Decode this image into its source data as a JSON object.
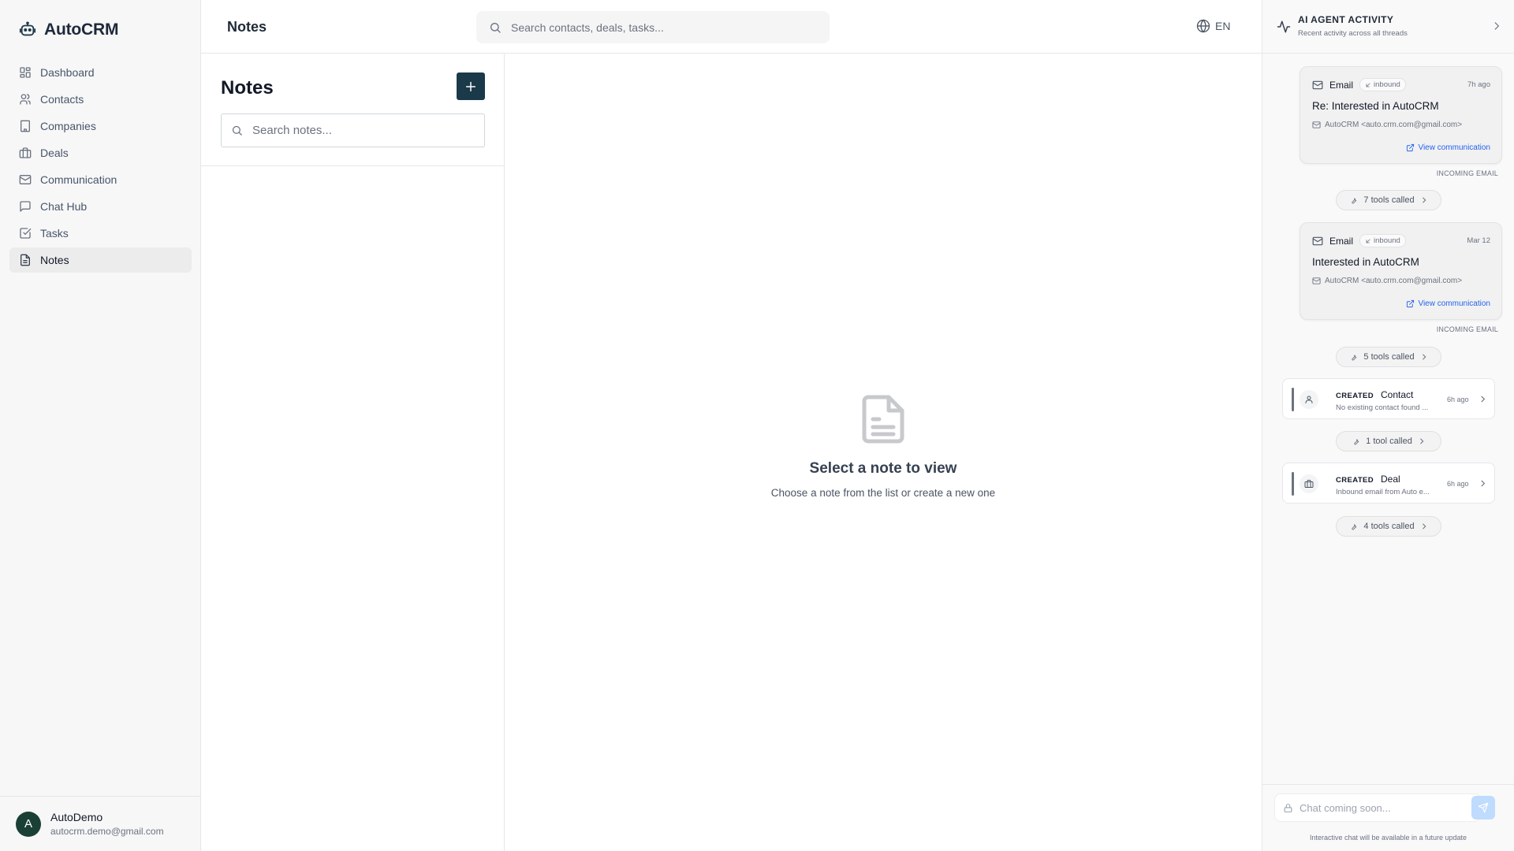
{
  "app": {
    "name": "AutoCRM"
  },
  "sidebar": {
    "items": [
      {
        "label": "Dashboard",
        "icon": "dashboard-icon"
      },
      {
        "label": "Contacts",
        "icon": "users-icon"
      },
      {
        "label": "Companies",
        "icon": "building-icon"
      },
      {
        "label": "Deals",
        "icon": "briefcase-icon"
      },
      {
        "label": "Communication",
        "icon": "mail-icon"
      },
      {
        "label": "Chat Hub",
        "icon": "chat-icon"
      },
      {
        "label": "Tasks",
        "icon": "checkbox-icon"
      },
      {
        "label": "Notes",
        "icon": "note-icon",
        "active": true
      }
    ],
    "user": {
      "initial": "A",
      "name": "AutoDemo",
      "email": "autocrm.demo@gmail.com"
    }
  },
  "header": {
    "title": "Notes",
    "search_placeholder": "Search contacts, deals, tasks...",
    "language": "EN"
  },
  "notes_panel": {
    "heading": "Notes",
    "add_label": "+",
    "search_placeholder": "Search notes..."
  },
  "main": {
    "empty_title": "Select a note to view",
    "empty_subtitle": "Choose a note from the list or create a new one"
  },
  "ai_panel": {
    "title": "AI AGENT ACTIVITY",
    "subtitle": "Recent activity across all threads",
    "communications": [
      {
        "type": "Email",
        "direction": "inbound",
        "time": "7h ago",
        "subject": "Re: Interested in AutoCRM",
        "from": "AutoCRM <auto.crm.com@gmail.com>",
        "link": "View communication",
        "label": "INCOMING EMAIL",
        "tools": "7 tools called"
      },
      {
        "type": "Email",
        "direction": "inbound",
        "time": "Mar 12",
        "subject": "Interested in AutoCRM",
        "from": "AutoCRM <auto.crm.com@gmail.com>",
        "link": "View communication",
        "label": "INCOMING EMAIL",
        "tools": "5 tools called"
      }
    ],
    "activities": [
      {
        "verb": "CREATED",
        "entity": "Contact",
        "description": "No existing contact found ...",
        "time": "6h ago",
        "tools": "1 tool called"
      },
      {
        "verb": "CREATED",
        "entity": "Deal",
        "description": "Inbound email from Auto e...",
        "time": "6h ago",
        "tools": "4 tools called"
      }
    ],
    "chat_placeholder": "Chat coming soon...",
    "chat_note": "Interactive chat will be available in a future update"
  },
  "colors": {
    "brand_dark": "#1a3a4a",
    "avatar": "#1a4036",
    "link": "#2563eb",
    "send_button": "#bfdbfe"
  }
}
